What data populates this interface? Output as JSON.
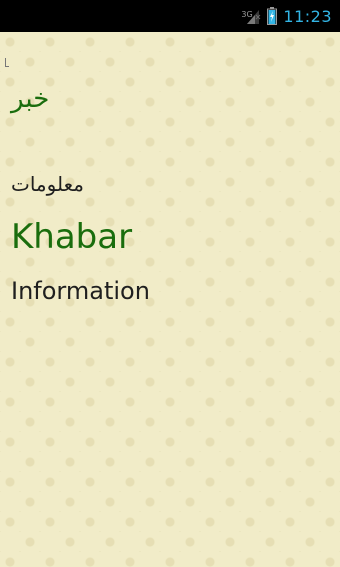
{
  "status_bar": {
    "network_type": "3G",
    "time": "11:23",
    "accent_color": "#33b5e5"
  },
  "content": {
    "arabic_title": "خبر",
    "arabic_subtitle": "معلومات",
    "latin_title": "Khabar",
    "latin_subtitle": "Information",
    "title_color": "#1a6d0d",
    "background_color": "#f1ecc8"
  },
  "icons": {
    "signal": "cellular-signal-icon",
    "battery": "battery-charging-icon"
  }
}
